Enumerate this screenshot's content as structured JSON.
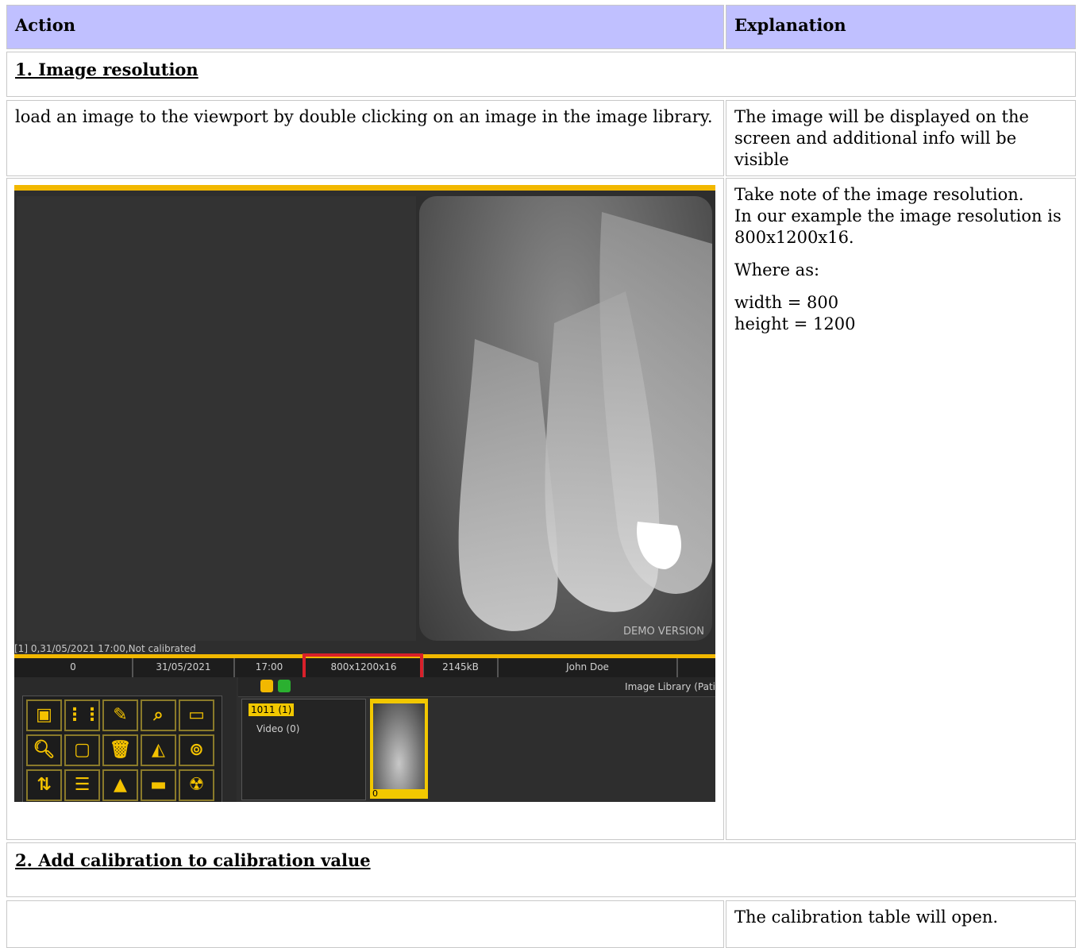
{
  "table": {
    "header": {
      "action": "Action",
      "explanation": "Explanation"
    },
    "section1": {
      "title": "1. Image resolution",
      "row1": {
        "action": "load an image to the viewport by double clicking on an image in the image library.",
        "explanation": "The image will be displayed on the screen and additional info will be visible"
      },
      "row2": {
        "explanation_lines": [
          "Take note of the image resolution.",
          "In our example the image resolution is 800x1200x16.",
          "Where as:",
          "width = 800",
          "height = 1200"
        ]
      }
    },
    "section2": {
      "title": "2. Add calibration to calibration value",
      "row1": {
        "explanation": "The calibration table will open."
      }
    }
  },
  "screenshot": {
    "watermark": "DEMO VERSION",
    "status_line": "[1] 0,31/05/2021 17:00,Not calibrated",
    "info_fields": [
      "0",
      "31/05/2021",
      "17:00",
      "800x1200x16",
      "2145kB",
      "John Doe",
      ""
    ],
    "library_title": "Image Library (Pati",
    "tree": {
      "selected": "1011 (1)",
      "video": "Video (0)"
    },
    "thumbnail_label": "0",
    "highlight_color": "#d8202a",
    "accent_color": "#f2b800"
  }
}
